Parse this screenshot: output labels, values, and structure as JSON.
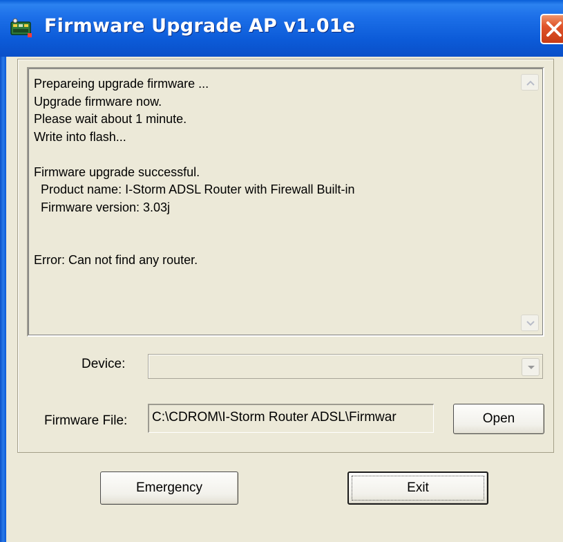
{
  "window": {
    "title": "Firmware Upgrade AP v1.01e",
    "app_icon": "router-app-icon",
    "close_icon": "close-icon"
  },
  "log": {
    "lines": [
      "Prepareing upgrade firmware ...",
      "Upgrade firmware now.",
      "Please wait about 1 minute.",
      "Write into flash...",
      "",
      "Firmware upgrade successful.",
      "  Product name: I-Storm ADSL Router with Firewall Built-in",
      "  Firmware version: 3.03j",
      "",
      "",
      "Error: Can not find any router."
    ]
  },
  "device": {
    "label": "Device:",
    "value": ""
  },
  "firmware_file": {
    "label": "Firmware File:",
    "value": "C:\\CDROM\\I-Storm Router ADSL\\Firmwar"
  },
  "buttons": {
    "open": "Open",
    "emergency": "Emergency",
    "exit": "Exit"
  },
  "colors": {
    "titlebar": "#0c5bd8",
    "dialog_bg": "#ece9d8",
    "close_button": "#e0542a"
  }
}
